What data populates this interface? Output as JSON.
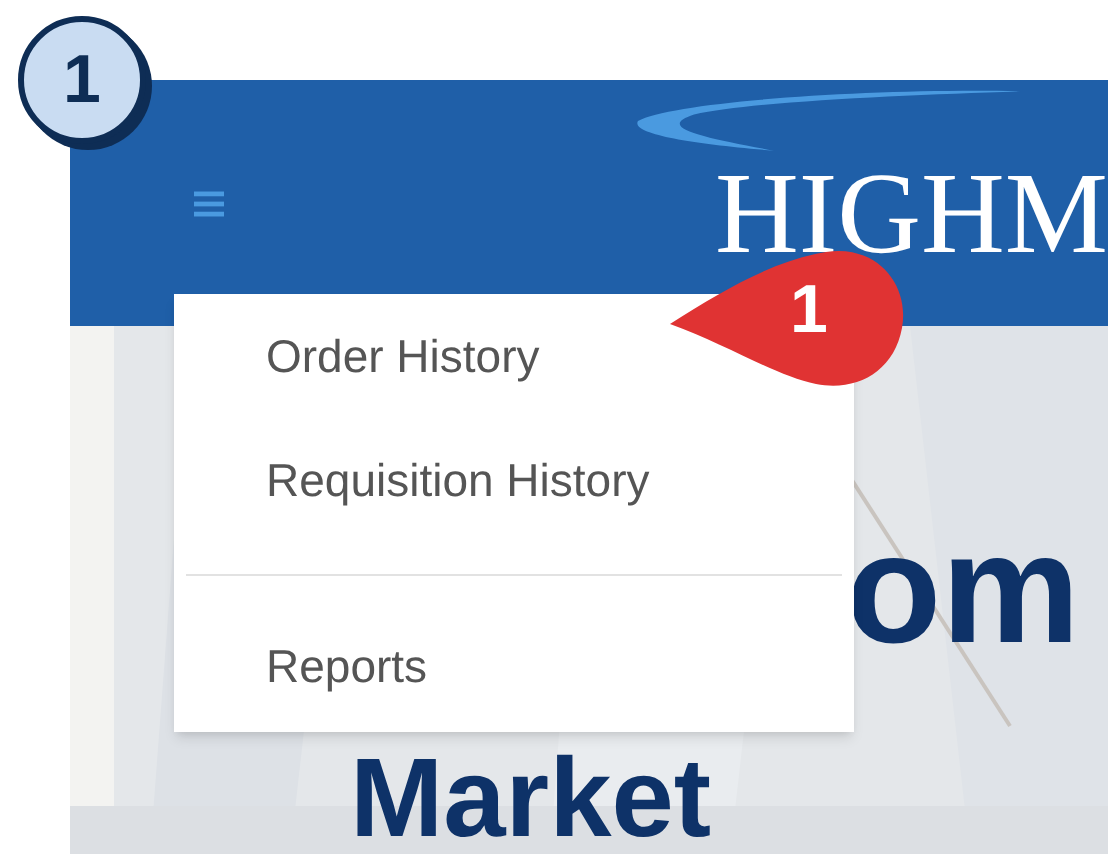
{
  "step_badge": "1",
  "header": {
    "logo": "HIGHM"
  },
  "menu": {
    "items": [
      {
        "kind": "link",
        "label": "Order History"
      },
      {
        "kind": "link",
        "label": "Requisition History"
      },
      {
        "kind": "divider"
      },
      {
        "kind": "link",
        "label": "Reports"
      }
    ]
  },
  "callout": "1",
  "hero": {
    "lines": [
      "om",
      "Market"
    ]
  }
}
